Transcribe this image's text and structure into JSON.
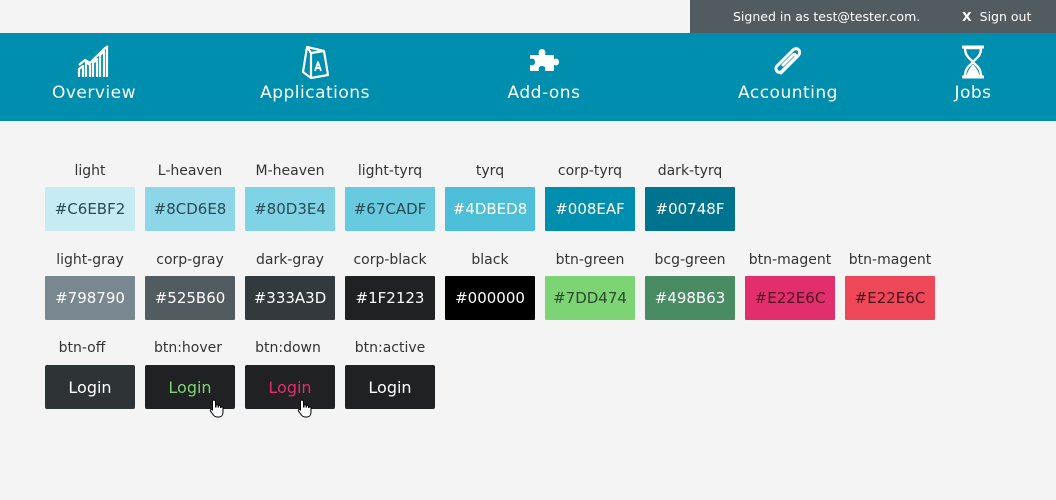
{
  "userbar": {
    "signed_in_text": "Signed in as test@tester.com.",
    "signout_x": "X",
    "signout_label": "Sign out"
  },
  "nav": [
    {
      "label": "Overview",
      "icon": "chart-icon"
    },
    {
      "label": "Applications",
      "icon": "cube-icon"
    },
    {
      "label": "Add-ons",
      "icon": "puzzle-icon"
    },
    {
      "label": "Accounting",
      "icon": "paperclip-icon"
    },
    {
      "label": "Jobs",
      "icon": "hourglass-icon"
    }
  ],
  "row1": [
    {
      "name": "light",
      "hex": "#C6EBF2",
      "color": "#C6EBF2"
    },
    {
      "name": "L-heaven",
      "hex": "#8CD6E8",
      "color": "#8CD6E8"
    },
    {
      "name": "M-heaven",
      "hex": "#80D3E4",
      "color": "#80D3E4"
    },
    {
      "name": "light-tyrq",
      "hex": "#67CADF",
      "color": "#67CADF"
    },
    {
      "name": "tyrq",
      "hex": "#4DBED8",
      "color": "#4DBED8"
    },
    {
      "name": "corp-tyrq",
      "hex": "#008EAF",
      "color": "#008EAF"
    },
    {
      "name": "dark-tyrq",
      "hex": "#00748F",
      "color": "#00748F"
    }
  ],
  "row2": [
    {
      "name": "light-gray",
      "hex": "#798790",
      "color": "#798790"
    },
    {
      "name": "corp-gray",
      "hex": "#525B60",
      "color": "#525B60"
    },
    {
      "name": "dark-gray",
      "hex": "#333A3D",
      "color": "#333A3D"
    },
    {
      "name": "corp-black",
      "hex": "#1F2123",
      "color": "#1F2123"
    },
    {
      "name": "black",
      "hex": "#000000",
      "color": "#000000"
    },
    {
      "name": "btn-green",
      "hex": "#7DD474",
      "color": "#7DD474"
    },
    {
      "name": "bcg-green",
      "hex": "#498B63",
      "color": "#498B63"
    },
    {
      "name": "btn-magent",
      "hex": "#E22E6C",
      "color": "#E22E6C"
    },
    {
      "name": "btn-magent",
      "hex": "#E22E6C",
      "color": "#EE4858"
    }
  ],
  "buttons": [
    {
      "name": "btn-off",
      "label": "Login",
      "bg": "#2e3336",
      "fg": "#ffffff"
    },
    {
      "name": "btn:hover",
      "label": "Login",
      "bg": "#1f2123",
      "fg": "#7DD474"
    },
    {
      "name": "btn:down",
      "label": "Login",
      "bg": "#1f2123",
      "fg": "#E22E6C"
    },
    {
      "name": "btn:active",
      "label": "Login",
      "bg": "#1f2123",
      "fg": "#ffffff"
    }
  ]
}
